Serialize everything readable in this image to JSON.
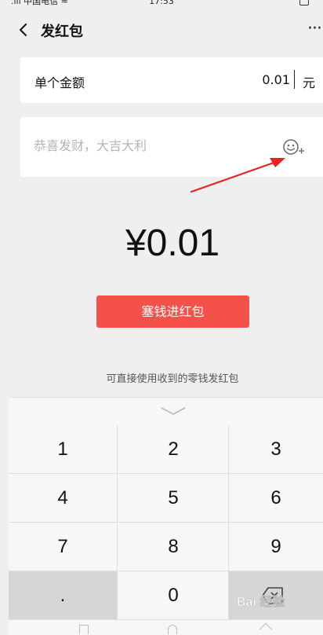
{
  "status_bar": {
    "carrier": ".ııl 中国电信 ≈",
    "time": "17:53"
  },
  "header": {
    "title": "发红包",
    "more_label": "···"
  },
  "amount_row": {
    "label": "单个金额",
    "value": "0.01",
    "unit": "元"
  },
  "greeting": {
    "placeholder": "恭喜发财，大吉大利"
  },
  "total": {
    "display": "¥0.01"
  },
  "send_button": {
    "label": "塞钱进红包"
  },
  "tip": {
    "text": "可直接使用收到的零钱发红包"
  },
  "keyboard": {
    "keys": [
      "1",
      "2",
      "3",
      "4",
      "5",
      "6",
      "7",
      "8",
      "9",
      ".",
      "0"
    ]
  },
  "watermark": {
    "text": "Bai 经验"
  },
  "colors": {
    "accent": "#f3514a",
    "background": "#efefef",
    "card": "#ffffff",
    "placeholder": "#b4b4b4",
    "arrow": "#e8231f"
  },
  "icons": {
    "back": "chevron-left-icon",
    "more": "more-dots-icon",
    "emoji": "emoji-add-icon",
    "collapse": "chevron-down-icon",
    "backspace": "backspace-icon"
  }
}
